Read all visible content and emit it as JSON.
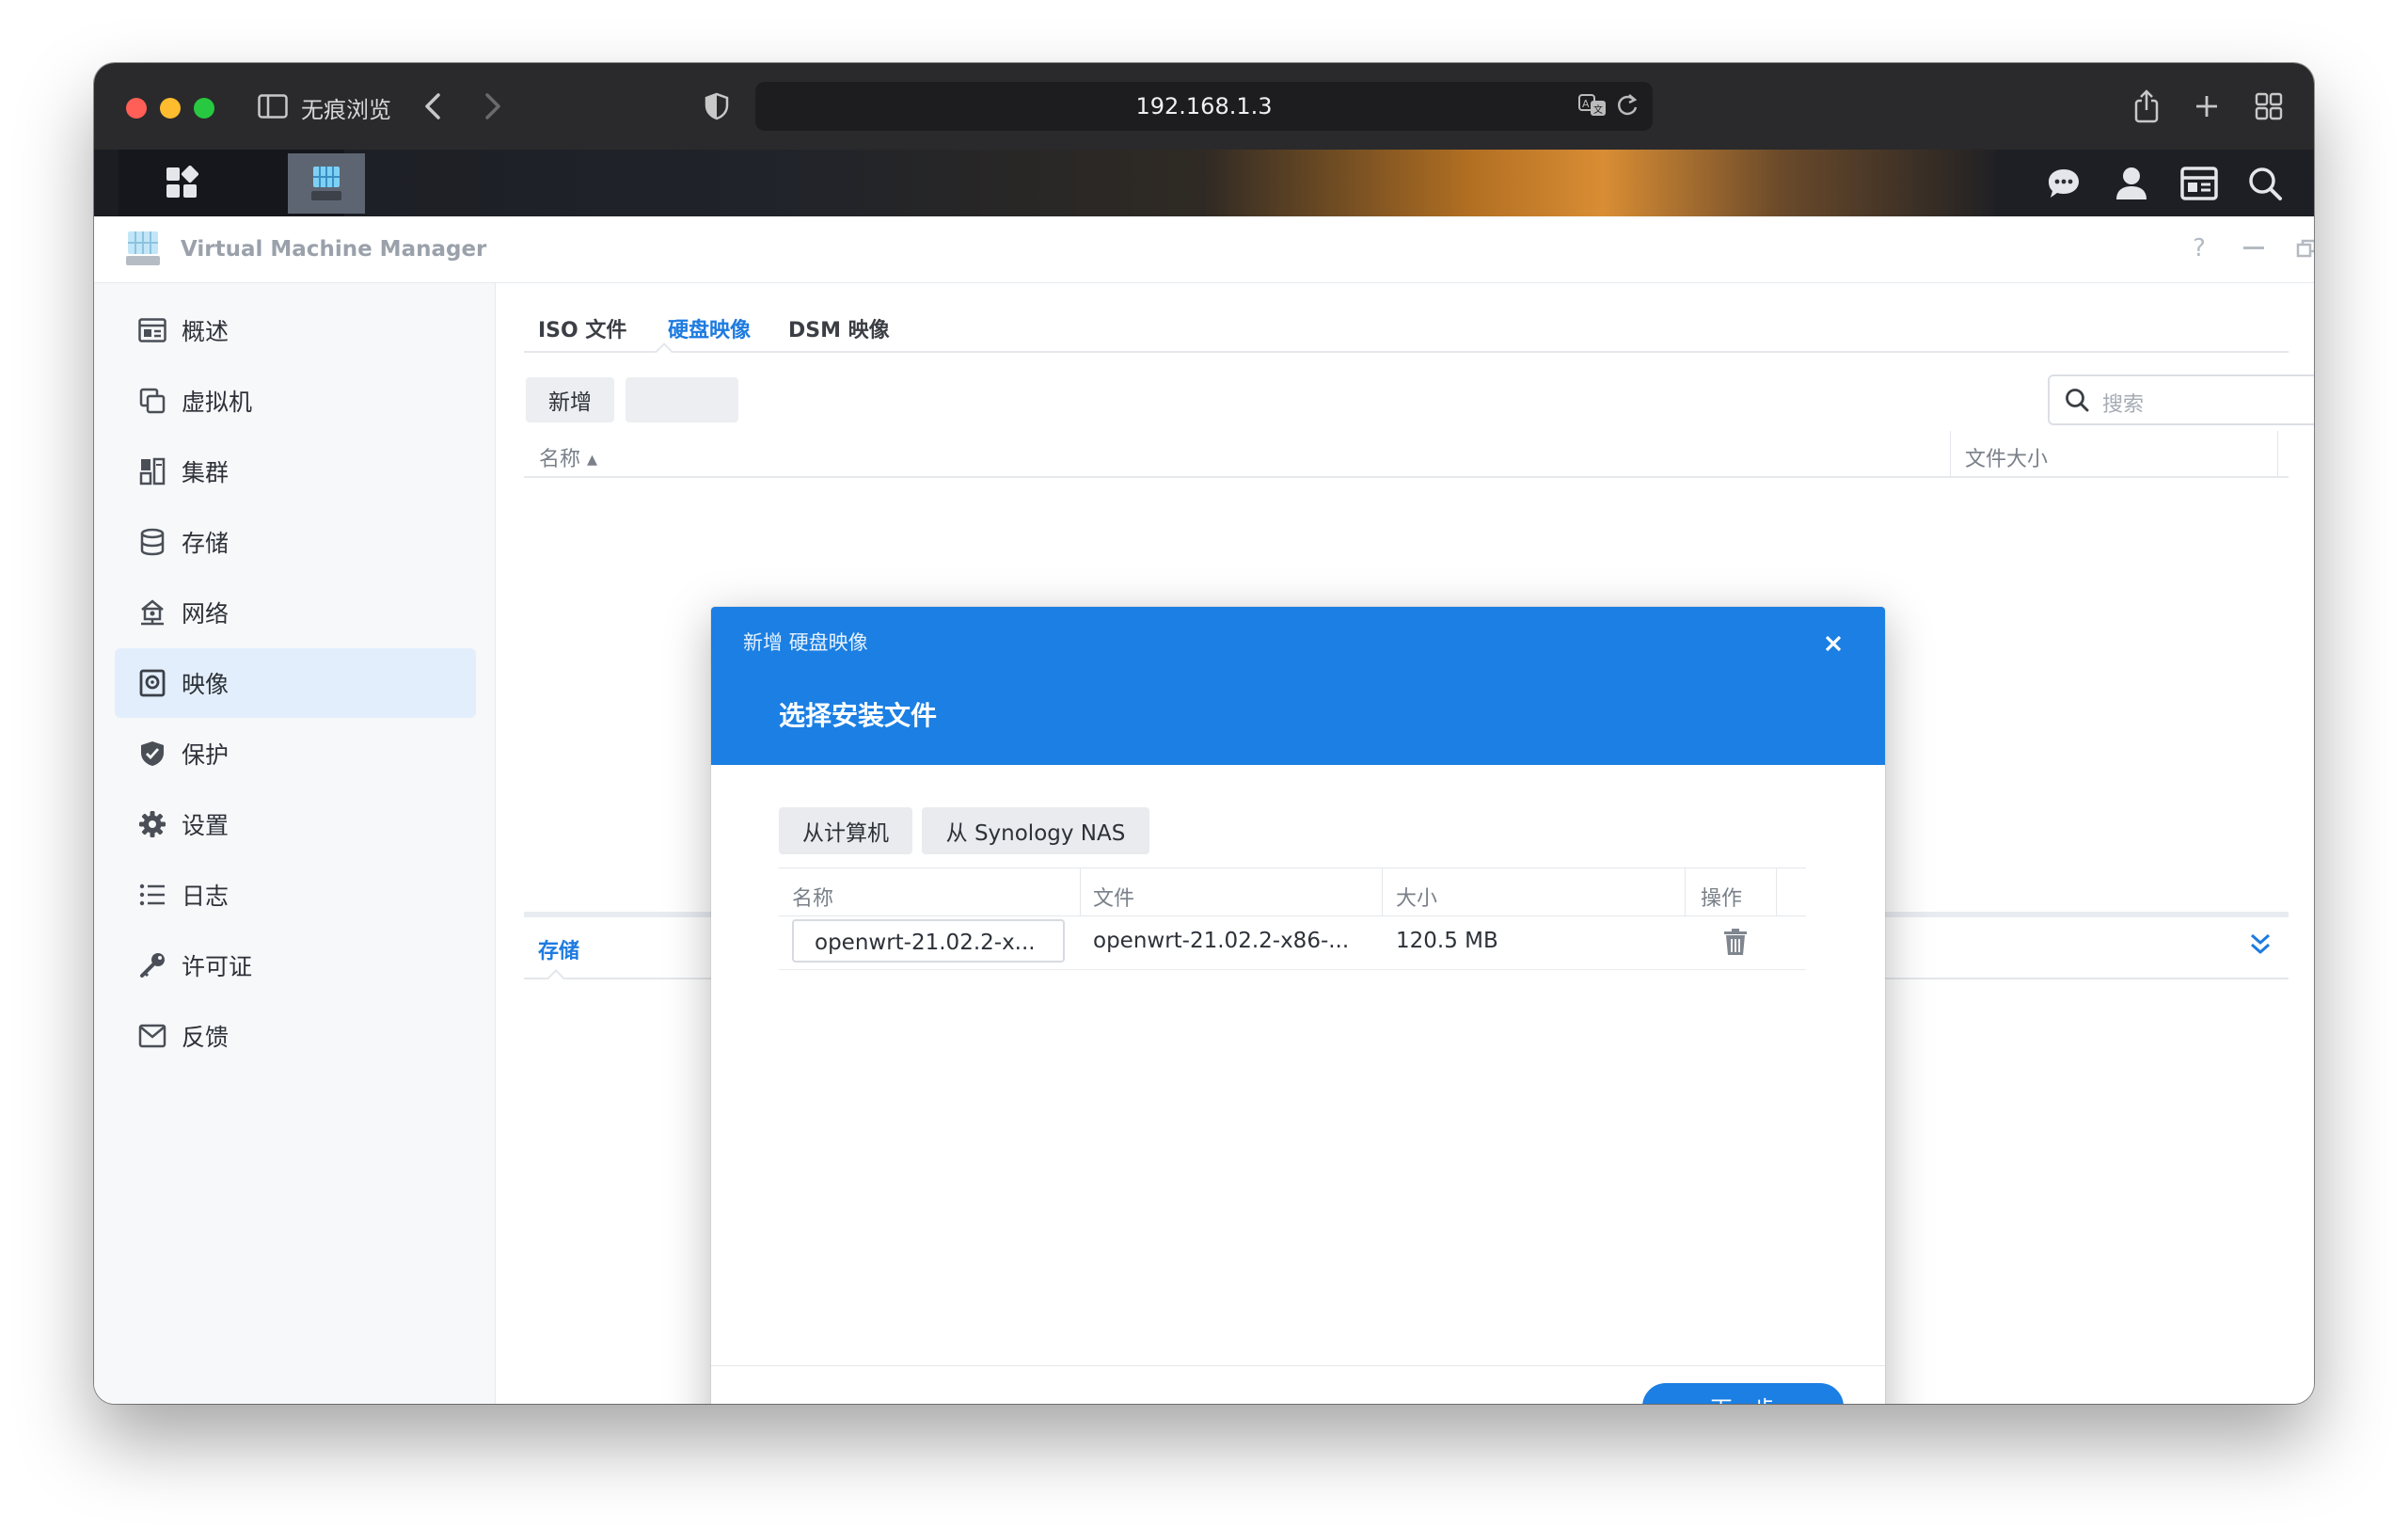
{
  "browser": {
    "private_label": "无痕浏览",
    "url": "192.168.1.3"
  },
  "app": {
    "title": "Virtual Machine Manager",
    "window_controls": {
      "help": "?"
    }
  },
  "sidebar": {
    "items": [
      {
        "label": "概述",
        "icon": "overview-icon"
      },
      {
        "label": "虚拟机",
        "icon": "vm-icon"
      },
      {
        "label": "集群",
        "icon": "cluster-icon"
      },
      {
        "label": "存储",
        "icon": "storage-icon"
      },
      {
        "label": "网络",
        "icon": "network-icon"
      },
      {
        "label": "映像",
        "icon": "image-icon",
        "active": true
      },
      {
        "label": "保护",
        "icon": "shield-icon"
      },
      {
        "label": "设置",
        "icon": "gear-icon"
      },
      {
        "label": "日志",
        "icon": "list-icon"
      },
      {
        "label": "许可证",
        "icon": "key-icon"
      },
      {
        "label": "反馈",
        "icon": "mail-icon"
      }
    ]
  },
  "main": {
    "tabs": [
      {
        "label": "ISO 文件"
      },
      {
        "label": "硬盘映像",
        "active": true
      },
      {
        "label": "DSM 映像"
      }
    ],
    "add_button": "新增",
    "search_placeholder": "搜索",
    "grid_headers": {
      "name": "名称",
      "size": "文件大小"
    },
    "lower_tab": "存储"
  },
  "dialog": {
    "title": "新增 硬盘映像",
    "step_title": "选择安装文件",
    "source_buttons": {
      "computer": "从计算机",
      "nas": "从 Synology NAS"
    },
    "table_headers": {
      "name": "名称",
      "file": "文件",
      "size": "大小",
      "action": "操作"
    },
    "rows": [
      {
        "name": "openwrt-21.02.2-x...",
        "file": "openwrt-21.02.2-x86-...",
        "size": "120.5 MB"
      }
    ],
    "next_button": "下一步"
  },
  "colors": {
    "accent": "#1b7fe3",
    "active_nav_bg": "#e2eefb"
  }
}
